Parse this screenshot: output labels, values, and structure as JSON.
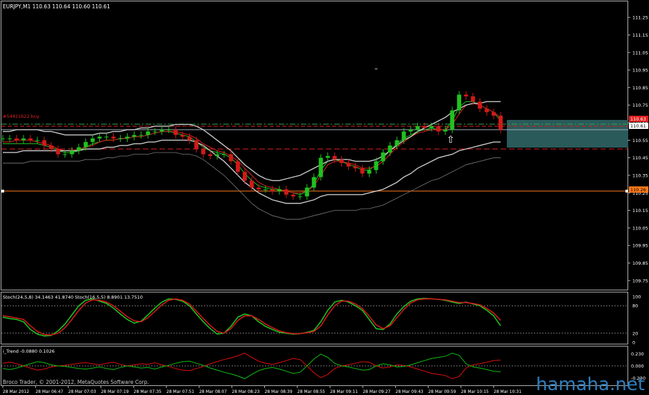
{
  "colors": {
    "bg": "#000000",
    "frame": "#b0b0b0",
    "bull": "#1fc21f",
    "bear": "#d01a1a",
    "ma_red": "#e02020",
    "band": "#c8c8c8",
    "band_outer": "#7a7a7a",
    "price_line": "#9fb2c0",
    "level": "#ff7a1a",
    "dash_red": "#e02020",
    "dash_green": "#2fa84f",
    "zone": "#2a5a5a",
    "stoch_main": "#c8c8c8",
    "trend_red": "#e01010",
    "trend_green": "#10c010",
    "watermark": "#2f7fbf"
  },
  "main_header": "EURJPY,M1  110.63 110.64 110.60 110.61",
  "order_label": "#54421622 buy",
  "price_badges": {
    "current": "110.61",
    "order": "110.63",
    "level": "110.26"
  },
  "stoch_header": "Stoch(24,5,8) 34.1463 41.8740  Stoch(16,5,5) 8.8901 13.7510",
  "trend_header": "i_Trend -0.0880 0.1026",
  "copyright": "Broco Trader, © 2001-2012, MetaQuotes Software Corp.",
  "watermark": "hamaha.net",
  "chart_data": [
    {
      "type": "line",
      "title": "EURJPY,M1",
      "y_ticks": [
        "111.25",
        "111.15",
        "111.05",
        "110.95",
        "110.85",
        "110.75",
        "110.65",
        "110.55",
        "110.45",
        "110.35",
        "110.25",
        "110.15",
        "110.05",
        "109.95",
        "109.85",
        "109.75"
      ],
      "ylim": [
        109.71,
        111.29
      ],
      "x_ticks": [
        "28 Mar 2012",
        "28 Mar 06:47",
        "28 Mar 07:03",
        "28 Mar 07:19",
        "28 Mar 07:35",
        "28 Mar 07:51",
        "28 Mar 08:07",
        "28 Mar 08:23",
        "28 Mar 08:39",
        "28 Mar 08:55",
        "28 Mar 09:11",
        "28 Mar 09:27",
        "28 Mar 09:43",
        "28 Mar 09:59",
        "28 Mar 10:15",
        "28 Mar 10:31"
      ],
      "levels": {
        "current": 110.61,
        "order": 110.63,
        "stop": 110.5,
        "horizontal": 110.26
      },
      "x": [
        0,
        10,
        20,
        30,
        40,
        50,
        60,
        70,
        80,
        90,
        100,
        110,
        120,
        130,
        140,
        150,
        160,
        170,
        180,
        190,
        200,
        210,
        220,
        230,
        240,
        250,
        260,
        270,
        280,
        290,
        300,
        310,
        320,
        330,
        340,
        350,
        360,
        370,
        380,
        390,
        400,
        410,
        420,
        430,
        440,
        450,
        460,
        470,
        480,
        490,
        500,
        510,
        520,
        530,
        540,
        550,
        560,
        570,
        580,
        590,
        600,
        610,
        620,
        630,
        640,
        650,
        660,
        670,
        680,
        690,
        700,
        710,
        720
      ],
      "close": [
        110.56,
        110.56,
        110.55,
        110.56,
        110.55,
        110.55,
        110.52,
        110.5,
        110.47,
        110.47,
        110.49,
        110.51,
        110.54,
        110.56,
        110.57,
        110.57,
        110.56,
        110.56,
        110.57,
        110.58,
        110.58,
        110.6,
        110.6,
        110.61,
        110.61,
        110.58,
        110.57,
        110.55,
        110.5,
        110.47,
        110.46,
        110.47,
        110.47,
        110.43,
        110.37,
        110.32,
        110.28,
        110.27,
        110.27,
        110.26,
        110.27,
        110.24,
        110.23,
        110.23,
        110.28,
        110.34,
        110.45,
        110.46,
        110.44,
        110.42,
        110.4,
        110.39,
        110.36,
        110.38,
        110.43,
        110.48,
        110.52,
        110.55,
        110.6,
        110.61,
        110.63,
        110.62,
        110.63,
        110.6,
        110.61,
        110.72,
        110.81,
        110.8,
        110.77,
        110.73,
        110.71,
        110.69,
        110.61
      ],
      "series": [
        {
          "name": "",
          "values": [
            110.53,
            110.53,
            110.53,
            110.53,
            110.53,
            110.53,
            110.52,
            110.51,
            110.49,
            110.48,
            110.48,
            110.49,
            110.51,
            110.53,
            110.54,
            110.55,
            110.55,
            110.56,
            110.56,
            110.57,
            110.57,
            110.58,
            110.59,
            110.6,
            110.6,
            110.59,
            110.58,
            110.57,
            110.54,
            110.51,
            110.49,
            110.48,
            110.47,
            110.45,
            110.41,
            110.36,
            110.32,
            110.29,
            110.28,
            110.27,
            110.27,
            110.26,
            110.25,
            110.24,
            110.26,
            110.3,
            110.38,
            110.43,
            110.44,
            110.43,
            110.41,
            110.4,
            110.38,
            110.38,
            110.41,
            110.45,
            110.49,
            110.53,
            110.56,
            110.58,
            110.6,
            110.61,
            110.62,
            110.61,
            110.61,
            110.66,
            110.74,
            110.77,
            110.77,
            110.75,
            110.73,
            110.71,
            110.66
          ]
        },
        {
          "name": "",
          "values": [
            110.54,
            110.54,
            110.55,
            110.55,
            110.55,
            110.54,
            110.53,
            110.52,
            110.5,
            110.49,
            110.49,
            110.5,
            110.51,
            110.52,
            110.54,
            110.55,
            110.55,
            110.56,
            110.56,
            110.57,
            110.57,
            110.58,
            110.59,
            110.6,
            110.6,
            110.6,
            110.59,
            110.58,
            110.56,
            110.53,
            110.51,
            110.49,
            110.48,
            110.46,
            110.43,
            110.39,
            110.35,
            110.31,
            110.29,
            110.28,
            110.27,
            110.26,
            110.25,
            110.25,
            110.26,
            110.29,
            110.35,
            110.41,
            110.43,
            110.43,
            110.42,
            110.41,
            110.39,
            110.39,
            110.4,
            110.43,
            110.47,
            110.51,
            110.54,
            110.57,
            110.59,
            110.6,
            110.61,
            110.61,
            110.61,
            110.64,
            110.7,
            110.75,
            110.76,
            110.75,
            110.73,
            110.71,
            110.68
          ]
        },
        {
          "name": "",
          "values": [
            110.6,
            110.6,
            110.61,
            110.61,
            110.61,
            110.61,
            110.6,
            110.6,
            110.59,
            110.58,
            110.58,
            110.58,
            110.58,
            110.58,
            110.59,
            110.59,
            110.6,
            110.6,
            110.61,
            110.61,
            110.62,
            110.62,
            110.63,
            110.63,
            110.63,
            110.64,
            110.64,
            110.64,
            110.63,
            110.61,
            110.58,
            110.55,
            110.52,
            110.49,
            110.45,
            110.41,
            110.38,
            110.35,
            110.33,
            110.32,
            110.32,
            110.33,
            110.34,
            110.35,
            110.37,
            110.39,
            110.41,
            110.43,
            110.44,
            110.44,
            110.44,
            110.43,
            110.43,
            110.43,
            110.44,
            110.46,
            110.49,
            110.52,
            110.55,
            110.57,
            110.6,
            110.62,
            110.64,
            110.66,
            110.68,
            110.71,
            110.73,
            110.75,
            110.76,
            110.76,
            110.77,
            110.77,
            110.77
          ]
        },
        {
          "name": "",
          "values": [
            110.48,
            110.48,
            110.48,
            110.49,
            110.49,
            110.49,
            110.49,
            110.49,
            110.49,
            110.49,
            110.49,
            110.49,
            110.5,
            110.5,
            110.5,
            110.51,
            110.51,
            110.52,
            110.52,
            110.53,
            110.53,
            110.54,
            110.54,
            110.55,
            110.55,
            110.55,
            110.55,
            110.55,
            110.54,
            110.52,
            110.49,
            110.46,
            110.43,
            110.39,
            110.35,
            110.31,
            110.28,
            110.25,
            110.23,
            110.21,
            110.2,
            110.19,
            110.19,
            110.19,
            110.2,
            110.21,
            110.23,
            110.24,
            110.24,
            110.24,
            110.24,
            110.24,
            110.24,
            110.25,
            110.26,
            110.27,
            110.29,
            110.31,
            110.34,
            110.36,
            110.39,
            110.41,
            110.43,
            110.45,
            110.46,
            110.47,
            110.49,
            110.5,
            110.51,
            110.52,
            110.53,
            110.54,
            110.54
          ]
        },
        {
          "name": "",
          "values": [
            110.42,
            110.42,
            110.42,
            110.42,
            110.43,
            110.43,
            110.43,
            110.43,
            110.43,
            110.43,
            110.43,
            110.43,
            110.44,
            110.44,
            110.44,
            110.45,
            110.45,
            110.46,
            110.46,
            110.47,
            110.47,
            110.47,
            110.48,
            110.48,
            110.48,
            110.48,
            110.47,
            110.47,
            110.46,
            110.44,
            110.41,
            110.38,
            110.35,
            110.31,
            110.27,
            110.23,
            110.19,
            110.16,
            110.14,
            110.12,
            110.11,
            110.1,
            110.1,
            110.1,
            110.11,
            110.12,
            110.13,
            110.14,
            110.15,
            110.15,
            110.15,
            110.15,
            110.16,
            110.16,
            110.17,
            110.18,
            110.2,
            110.22,
            110.24,
            110.26,
            110.28,
            110.3,
            110.32,
            110.33,
            110.35,
            110.37,
            110.39,
            110.41,
            110.42,
            110.43,
            110.44,
            110.45,
            110.45
          ]
        }
      ]
    },
    {
      "type": "line",
      "title": "Stoch(24,5,8)",
      "y_ticks": [
        "100",
        "80",
        "20",
        "0"
      ],
      "ylim": [
        0,
        100
      ],
      "levels": [
        80,
        20
      ],
      "x": [
        0,
        10,
        20,
        30,
        40,
        50,
        60,
        70,
        80,
        90,
        100,
        110,
        120,
        130,
        140,
        150,
        160,
        170,
        180,
        190,
        200,
        210,
        220,
        230,
        240,
        250,
        260,
        270,
        280,
        290,
        300,
        310,
        320,
        330,
        340,
        350,
        360,
        370,
        380,
        390,
        400,
        410,
        420,
        430,
        440,
        450,
        460,
        470,
        480,
        490,
        500,
        510,
        520,
        530,
        540,
        550,
        560,
        570,
        580,
        590,
        600,
        610,
        620,
        630,
        640,
        650,
        660,
        670,
        680,
        690,
        700,
        710,
        720
      ],
      "series": [
        {
          "name": "Stoch main",
          "values": [
            55,
            52,
            50,
            45,
            28,
            18,
            14,
            15,
            25,
            40,
            60,
            80,
            92,
            95,
            90,
            85,
            75,
            62,
            50,
            42,
            46,
            60,
            75,
            88,
            95,
            94,
            90,
            80,
            62,
            45,
            30,
            18,
            20,
            35,
            55,
            62,
            58,
            45,
            35,
            28,
            22,
            20,
            18,
            19,
            22,
            26,
            45,
            70,
            88,
            92,
            88,
            80,
            70,
            50,
            30,
            28,
            40,
            62,
            78,
            90,
            95,
            96,
            95,
            94,
            92,
            88,
            85,
            88,
            84,
            80,
            70,
            58,
            36
          ]
        },
        {
          "name": "Stoch signal",
          "values": [
            58,
            56,
            53,
            50,
            36,
            24,
            17,
            16,
            20,
            32,
            50,
            70,
            86,
            93,
            92,
            88,
            80,
            68,
            56,
            47,
            45,
            54,
            68,
            82,
            92,
            95,
            92,
            84,
            68,
            52,
            37,
            24,
            20,
            30,
            48,
            58,
            58,
            50,
            40,
            32,
            25,
            21,
            19,
            19,
            21,
            24,
            36,
            60,
            80,
            90,
            90,
            84,
            74,
            57,
            38,
            30,
            36,
            54,
            72,
            86,
            93,
            95,
            95,
            94,
            93,
            90,
            87,
            87,
            85,
            82,
            74,
            64,
            48
          ]
        }
      ]
    },
    {
      "type": "line",
      "title": "i_Trend",
      "y_ticks": [
        "0.230",
        "0.000",
        "-0.230"
      ],
      "ylim": [
        -0.3,
        0.3
      ],
      "x": [
        0,
        10,
        20,
        30,
        40,
        50,
        60,
        70,
        80,
        90,
        100,
        110,
        120,
        130,
        140,
        150,
        160,
        170,
        180,
        190,
        200,
        210,
        220,
        230,
        240,
        250,
        260,
        270,
        280,
        290,
        300,
        310,
        320,
        330,
        340,
        350,
        360,
        370,
        380,
        390,
        400,
        410,
        420,
        430,
        440,
        450,
        460,
        470,
        480,
        490,
        500,
        510,
        520,
        530,
        540,
        550,
        560,
        570,
        580,
        590,
        600,
        610,
        620,
        630,
        640,
        650,
        660,
        670,
        680,
        690,
        700,
        710,
        720
      ],
      "series": [
        {
          "name": "i_Trend red",
          "values": [
            0.05,
            0.07,
            0.04,
            0.0,
            -0.04,
            -0.08,
            -0.06,
            -0.02,
            0.0,
            0.01,
            0.03,
            0.05,
            0.06,
            0.04,
            0.02,
            0.05,
            0.07,
            0.03,
            0.0,
            0.02,
            0.04,
            0.03,
            0.06,
            0.02,
            -0.01,
            -0.05,
            -0.08,
            -0.09,
            -0.05,
            -0.01,
            0.04,
            0.08,
            0.12,
            0.15,
            0.19,
            0.24,
            0.16,
            0.09,
            0.05,
            0.03,
            0.06,
            0.1,
            0.14,
            0.12,
            0.0,
            -0.13,
            -0.22,
            -0.16,
            -0.05,
            0.0,
            0.02,
            0.05,
            0.08,
            0.07,
            0.0,
            -0.04,
            -0.02,
            0.02,
            0.01,
            -0.02,
            -0.06,
            -0.1,
            -0.14,
            -0.16,
            -0.18,
            -0.24,
            -0.2,
            -0.04,
            0.02,
            0.04,
            0.07,
            0.1,
            0.11
          ]
        },
        {
          "name": "i_Trend green",
          "values": [
            -0.05,
            -0.07,
            -0.04,
            0.0,
            0.04,
            0.08,
            0.06,
            0.02,
            0.0,
            -0.01,
            -0.03,
            -0.05,
            -0.06,
            -0.04,
            -0.02,
            -0.05,
            -0.07,
            -0.03,
            0.0,
            -0.02,
            -0.04,
            -0.03,
            -0.06,
            -0.02,
            0.01,
            0.05,
            0.08,
            0.09,
            0.05,
            0.01,
            -0.04,
            -0.08,
            -0.12,
            -0.15,
            -0.19,
            -0.24,
            -0.16,
            -0.09,
            -0.05,
            -0.03,
            -0.06,
            -0.1,
            -0.14,
            -0.12,
            0.0,
            0.13,
            0.22,
            0.16,
            0.05,
            0.0,
            -0.02,
            -0.05,
            -0.08,
            -0.07,
            0.0,
            0.04,
            0.02,
            -0.02,
            -0.01,
            0.02,
            0.06,
            0.1,
            0.14,
            0.16,
            0.18,
            0.24,
            0.2,
            0.04,
            -0.02,
            -0.04,
            -0.07,
            -0.1,
            -0.11
          ]
        }
      ]
    }
  ]
}
